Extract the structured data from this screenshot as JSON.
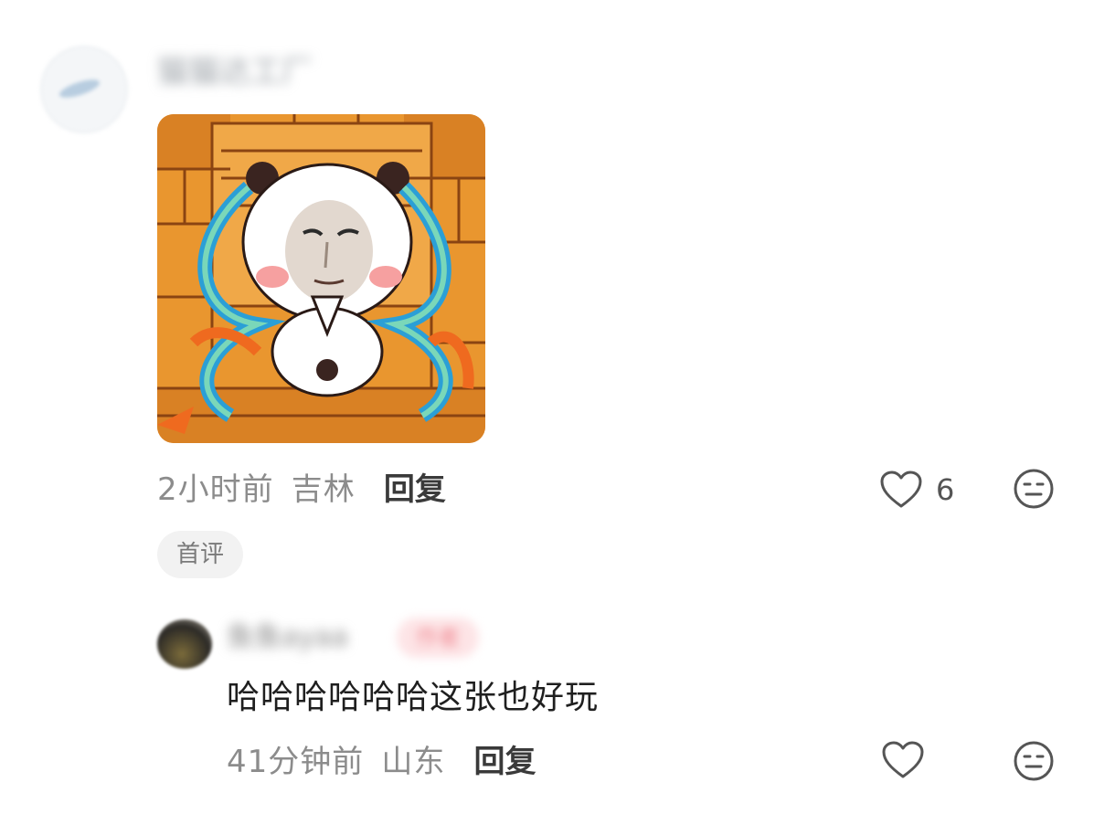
{
  "comment": {
    "username": "猫猫达工厂",
    "time": "2小时前",
    "location": "吉林",
    "reply_label": "回复",
    "like_count": "6",
    "badge": "首评"
  },
  "reply_comment": {
    "username": "鱼鱼ayaa",
    "tag": "作者",
    "text": "哈哈哈哈哈哈这张也好玩",
    "time": "41分钟前",
    "location": "山东",
    "reply_label": "回复"
  },
  "icons": {
    "like": "heart-outline-icon",
    "dislike": "neutral-face-icon"
  },
  "colors": {
    "secondary_text": "#8c8c8c",
    "primary_text": "#1f1f1f",
    "badge_bg": "#f2f2f2"
  }
}
